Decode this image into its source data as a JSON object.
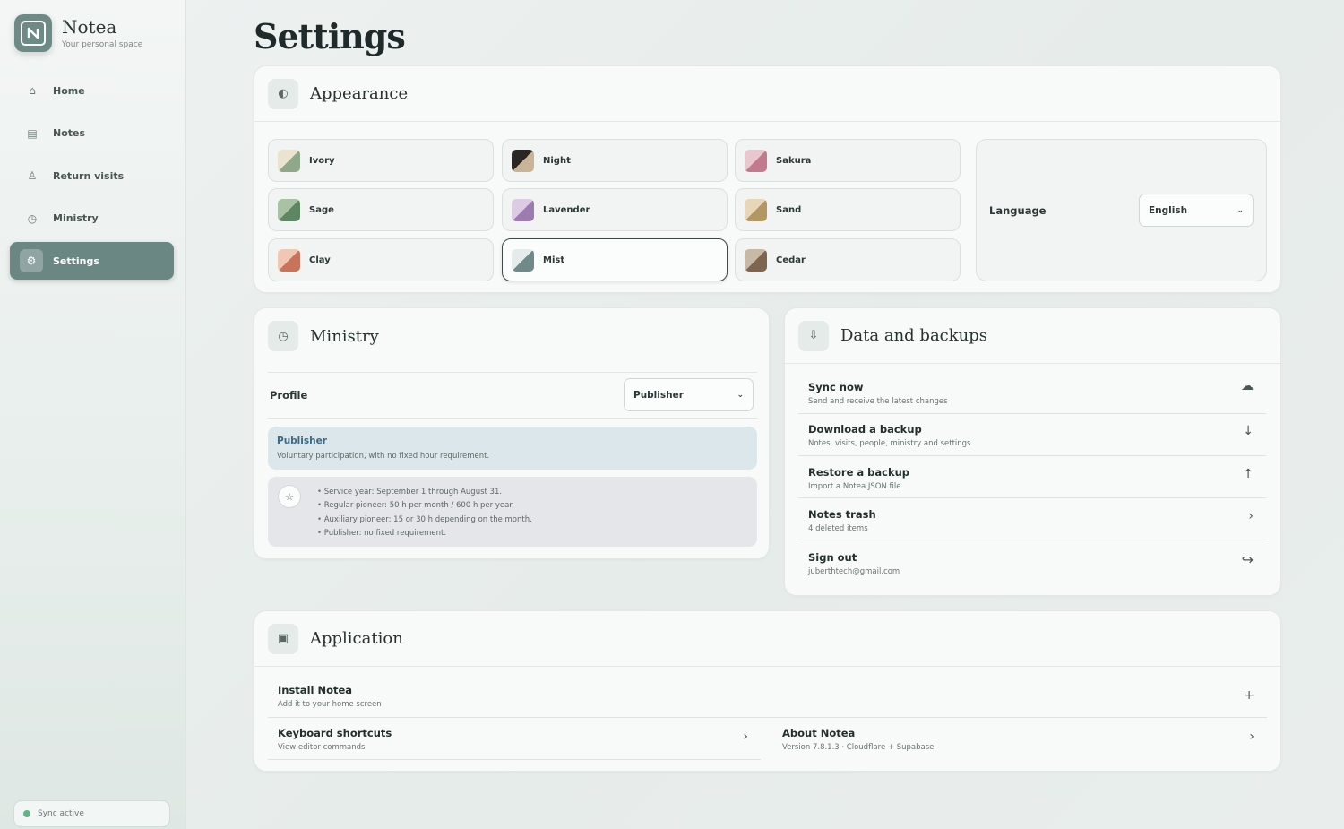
{
  "app": {
    "name": "Notea",
    "tagline": "Your personal space"
  },
  "nav": [
    {
      "label": "Home",
      "icon": "home-icon",
      "glyph": "⌂"
    },
    {
      "label": "Notes",
      "icon": "notes-icon",
      "glyph": "▤"
    },
    {
      "label": "Return visits",
      "icon": "person-icon",
      "glyph": "♙"
    },
    {
      "label": "Ministry",
      "icon": "clock-icon",
      "glyph": "◷"
    },
    {
      "label": "Settings",
      "icon": "gear-icon",
      "glyph": "⚙",
      "active": true
    }
  ],
  "sync_status": "Sync active",
  "page_title": "Settings",
  "appearance": {
    "title": "Appearance",
    "themes": [
      {
        "name": "Ivory",
        "c1": "#e9e3cf",
        "c2": "#8fa889"
      },
      {
        "name": "Night",
        "c1": "#2a2623",
        "c2": "#c9b49a"
      },
      {
        "name": "Sakura",
        "c1": "#e8c7cf",
        "c2": "#c27b8c"
      },
      {
        "name": "Sage",
        "c1": "#a9c2a6",
        "c2": "#5f8663"
      },
      {
        "name": "Lavender",
        "c1": "#ddcbe6",
        "c2": "#9b7bb0"
      },
      {
        "name": "Sand",
        "c1": "#e8d7b6",
        "c2": "#b49564"
      },
      {
        "name": "Clay",
        "c1": "#efc7b5",
        "c2": "#c8735a"
      },
      {
        "name": "Mist",
        "c1": "#e4eceb",
        "c2": "#6f8a88",
        "selected": true
      },
      {
        "name": "Cedar",
        "c1": "#c8b8a6",
        "c2": "#7d6550"
      }
    ],
    "language_label": "Language",
    "language_value": "English"
  },
  "ministry": {
    "title": "Ministry",
    "profile_label": "Profile",
    "profile_value": "Publisher",
    "profile_title": "Publisher",
    "profile_desc": "Voluntary participation, with no fixed hour requirement.",
    "rules": [
      "Service year: September 1 through August 31.",
      "Regular pioneer: 50 h per month / 600 h per year.",
      "Auxiliary pioneer: 15 or 30 h depending on the month.",
      "Publisher: no fixed requirement."
    ]
  },
  "data": {
    "title": "Data and backups",
    "rows": [
      {
        "title": "Sync now",
        "sub": "Send and receive the latest changes",
        "icon": "cloud-icon",
        "glyph": "☁"
      },
      {
        "title": "Download a backup",
        "sub": "Notes, visits, people, ministry and settings",
        "icon": "arrow-down-icon",
        "glyph": "↓"
      },
      {
        "title": "Restore a backup",
        "sub": "Import a Notea JSON file",
        "icon": "arrow-up-icon",
        "glyph": "↑"
      },
      {
        "title": "Notes trash",
        "sub": "4 deleted items",
        "icon": "chevron-right-icon",
        "glyph": "›"
      },
      {
        "title": "Sign out",
        "sub": "juberthtech@gmail.com",
        "icon": "sign-out-icon",
        "glyph": "↪"
      }
    ]
  },
  "application": {
    "title": "Application",
    "install": {
      "title": "Install Notea",
      "sub": "Add it to your home screen",
      "glyph": "+"
    },
    "shortcuts": {
      "title": "Keyboard shortcuts",
      "sub": "View editor commands",
      "glyph": "›"
    },
    "about": {
      "title": "About Notea",
      "sub": "Version 7.8.1.3 · Cloudflare + Supabase",
      "glyph": "›"
    }
  }
}
